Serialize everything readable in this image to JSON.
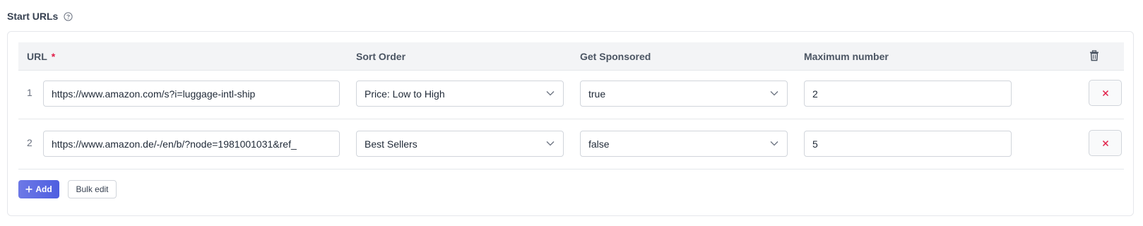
{
  "section": {
    "title": "Start URLs",
    "help_icon": "question-circle-icon"
  },
  "table": {
    "headers": {
      "url": "URL",
      "url_required_mark": "*",
      "sort_order": "Sort Order",
      "get_sponsored": "Get Sponsored",
      "maximum_number": "Maximum number"
    },
    "delete_all_icon": "trash-icon",
    "rows": [
      {
        "index": "1",
        "url": "https://www.amazon.com/s?i=luggage-intl-ship",
        "sort_order": "Price: Low to High",
        "get_sponsored": "true",
        "maximum_number": "2",
        "remove_icon": "close-icon"
      },
      {
        "index": "2",
        "url": "https://www.amazon.de/-/en/b/?node=1981001031&ref_",
        "sort_order": "Best Sellers",
        "get_sponsored": "false",
        "maximum_number": "5",
        "remove_icon": "close-icon"
      }
    ]
  },
  "actions": {
    "add_label": "Add",
    "add_icon": "plus-icon",
    "bulk_edit_label": "Bulk edit"
  },
  "colors": {
    "accent": "#5562e4",
    "required": "#e11d48",
    "remove": "#e11d48"
  }
}
